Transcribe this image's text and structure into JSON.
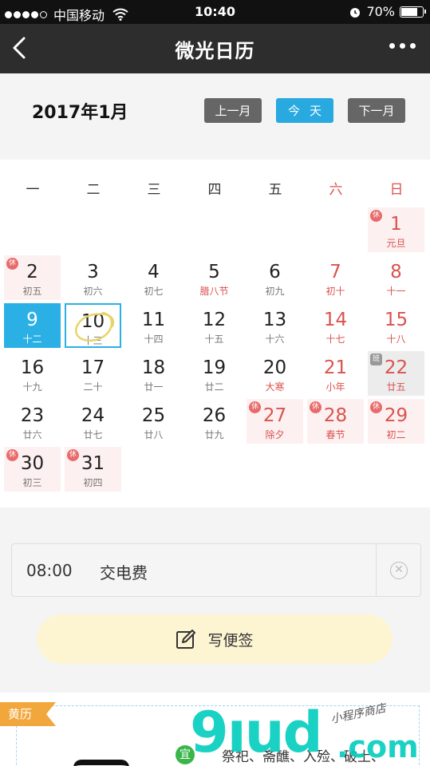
{
  "status": {
    "carrier": "中国移动",
    "time": "10:40",
    "battery": "70%",
    "battery_level": 0.7
  },
  "nav": {
    "title": "微光日历"
  },
  "month": {
    "title": "2017年1月",
    "prev_label": "上一月",
    "today_label": "今天",
    "next_label": "下一月"
  },
  "weekdays": [
    "一",
    "二",
    "三",
    "四",
    "五",
    "六",
    "日"
  ],
  "days": [
    {
      "num": "1",
      "sub": "元旦",
      "col": 6,
      "row": 0,
      "tag": "休",
      "holiday": true,
      "red": true,
      "sub_red": true
    },
    {
      "num": "2",
      "sub": "初五",
      "col": 0,
      "row": 1,
      "tag": "休",
      "holiday": true
    },
    {
      "num": "3",
      "sub": "初六",
      "col": 1,
      "row": 1
    },
    {
      "num": "4",
      "sub": "初七",
      "col": 2,
      "row": 1
    },
    {
      "num": "5",
      "sub": "腊八节",
      "col": 3,
      "row": 1,
      "sub_red": true
    },
    {
      "num": "6",
      "sub": "初九",
      "col": 4,
      "row": 1
    },
    {
      "num": "7",
      "sub": "初十",
      "col": 5,
      "row": 1,
      "red": true
    },
    {
      "num": "8",
      "sub": "十一",
      "col": 6,
      "row": 1,
      "red": true
    },
    {
      "num": "9",
      "sub": "十二",
      "col": 0,
      "row": 2,
      "selected": true
    },
    {
      "num": "10",
      "sub": "十三",
      "col": 1,
      "row": 2,
      "today": true
    },
    {
      "num": "11",
      "sub": "十四",
      "col": 2,
      "row": 2
    },
    {
      "num": "12",
      "sub": "十五",
      "col": 3,
      "row": 2
    },
    {
      "num": "13",
      "sub": "十六",
      "col": 4,
      "row": 2
    },
    {
      "num": "14",
      "sub": "十七",
      "col": 5,
      "row": 2,
      "red": true
    },
    {
      "num": "15",
      "sub": "十八",
      "col": 6,
      "row": 2,
      "red": true
    },
    {
      "num": "16",
      "sub": "十九",
      "col": 0,
      "row": 3
    },
    {
      "num": "17",
      "sub": "二十",
      "col": 1,
      "row": 3
    },
    {
      "num": "18",
      "sub": "廿一",
      "col": 2,
      "row": 3
    },
    {
      "num": "19",
      "sub": "廿二",
      "col": 3,
      "row": 3
    },
    {
      "num": "20",
      "sub": "大寒",
      "col": 4,
      "row": 3,
      "sub_red": true
    },
    {
      "num": "21",
      "sub": "小年",
      "col": 5,
      "row": 3,
      "red": true,
      "sub_red": true
    },
    {
      "num": "22",
      "sub": "廿五",
      "col": 6,
      "row": 3,
      "tag": "班",
      "work": true,
      "red": true
    },
    {
      "num": "23",
      "sub": "廿六",
      "col": 0,
      "row": 4
    },
    {
      "num": "24",
      "sub": "廿七",
      "col": 1,
      "row": 4
    },
    {
      "num": "25",
      "sub": "廿八",
      "col": 2,
      "row": 4
    },
    {
      "num": "26",
      "sub": "廿九",
      "col": 3,
      "row": 4
    },
    {
      "num": "27",
      "sub": "除夕",
      "col": 4,
      "row": 4,
      "tag": "休",
      "holiday": true,
      "red": true,
      "sub_red": true
    },
    {
      "num": "28",
      "sub": "春节",
      "col": 5,
      "row": 4,
      "tag": "休",
      "holiday": true,
      "red": true,
      "sub_red": true
    },
    {
      "num": "29",
      "sub": "初二",
      "col": 6,
      "row": 4,
      "tag": "休",
      "holiday": true,
      "red": true
    },
    {
      "num": "30",
      "sub": "初三",
      "col": 0,
      "row": 5,
      "tag": "休",
      "holiday": true
    },
    {
      "num": "31",
      "sub": "初四",
      "col": 1,
      "row": 5,
      "tag": "休",
      "holiday": true
    }
  ],
  "note": {
    "time": "08:00",
    "text": "交电费"
  },
  "memo": {
    "label": "写便签"
  },
  "almanac": {
    "ribbon": "黄历",
    "yi_badge": "宜",
    "yi_text": "祭祀、斋醮、入殓、破土、"
  },
  "watermark": {
    "brand": "9ıud",
    "suffix": ".com",
    "handwriting": "小程序商店"
  },
  "colors": {
    "accent": "#28a9e0",
    "holiday_red": "#d9534f",
    "nav_bg": "#2d2d2d",
    "memo_bg": "#fdf4d2",
    "almanac_badge": "#f2a73c"
  }
}
